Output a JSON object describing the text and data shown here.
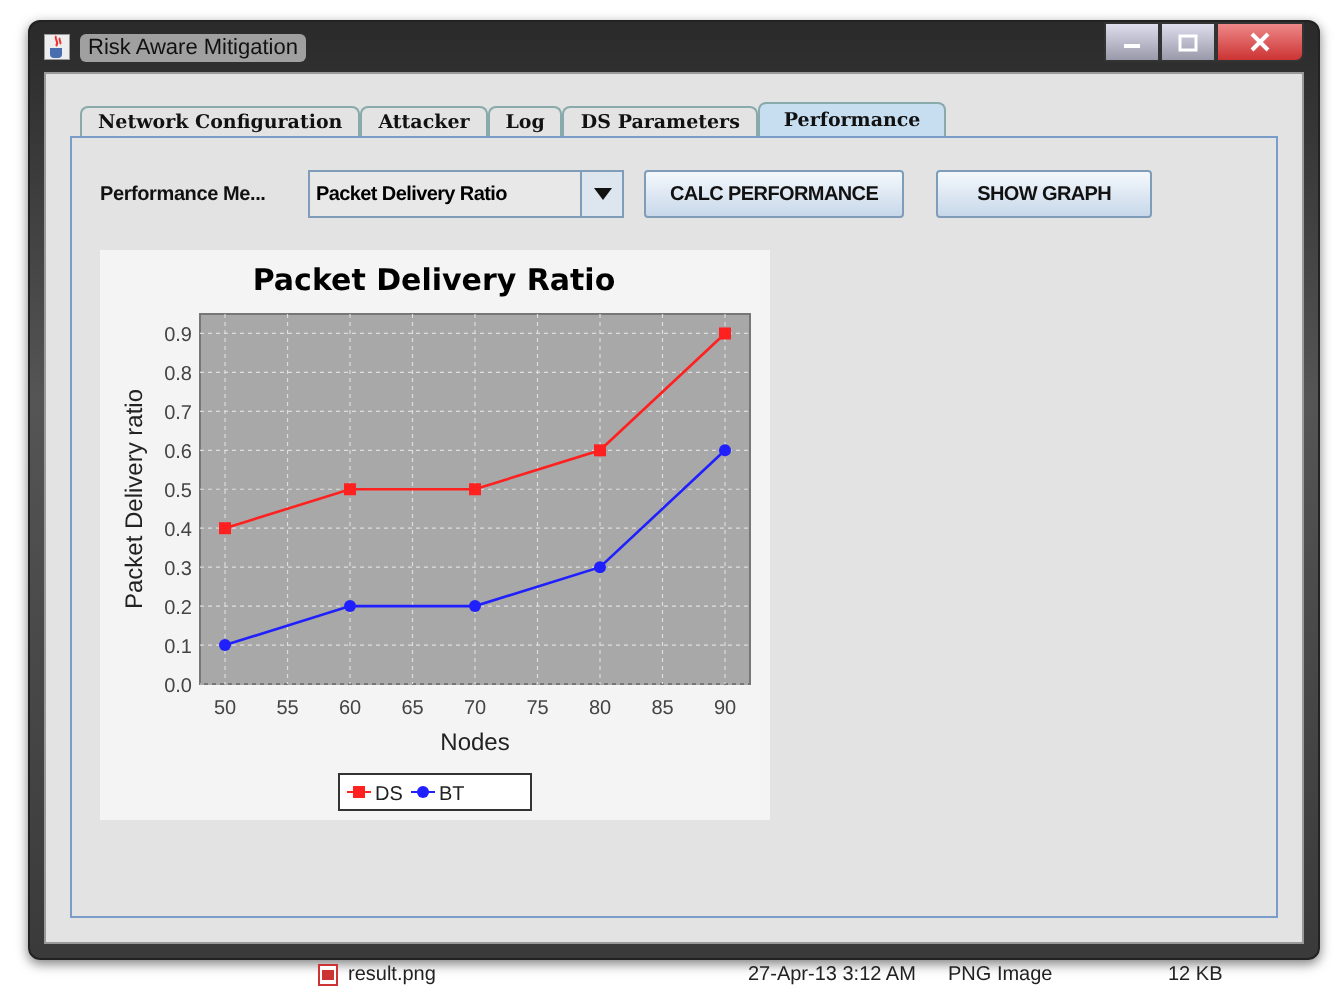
{
  "window": {
    "title": "Risk Aware Mitigation"
  },
  "tabs": [
    {
      "label": "Network Configuration",
      "selected": false
    },
    {
      "label": "Attacker",
      "selected": false
    },
    {
      "label": "Log",
      "selected": false
    },
    {
      "label": "DS Parameters",
      "selected": false
    },
    {
      "label": "Performance",
      "selected": true
    }
  ],
  "controls": {
    "label": "Performance Me...",
    "dropdown": {
      "value": "Packet Delivery Ratio"
    },
    "buttons": [
      "CALC PERFORMANCE",
      "SHOW GRAPH"
    ]
  },
  "chart": {
    "chart_data": {
      "type": "line",
      "title": "Packet Delivery Ratio",
      "xlabel": "Nodes",
      "ylabel": "Packet Delivery ratio",
      "x": [
        50,
        60,
        70,
        80,
        90
      ],
      "series": [
        {
          "name": "DS",
          "color": "#ff2020",
          "marker": "square",
          "values": [
            0.4,
            0.5,
            0.5,
            0.6,
            0.9
          ]
        },
        {
          "name": "BT",
          "color": "#2020ff",
          "marker": "circle",
          "values": [
            0.1,
            0.2,
            0.2,
            0.3,
            0.6
          ]
        }
      ],
      "grid": true,
      "legend": true,
      "xlim": [
        48,
        92
      ],
      "ylim": [
        0,
        0.95
      ],
      "xticks": [
        50,
        55,
        60,
        65,
        70,
        75,
        80,
        85,
        90
      ],
      "yticks": [
        {
          "value": 0,
          "label": "0.0"
        },
        {
          "value": 0.1,
          "label": "0.1"
        },
        {
          "value": 0.2,
          "label": "0.2"
        },
        {
          "value": 0.3,
          "label": "0.3"
        },
        {
          "value": 0.4,
          "label": "0.4"
        },
        {
          "value": 0.5,
          "label": "0.5"
        },
        {
          "value": 0.6,
          "label": "0.6"
        },
        {
          "value": 0.7,
          "label": "0.7"
        },
        {
          "value": 0.8,
          "label": "0.8"
        },
        {
          "value": 0.9,
          "label": "0.9"
        }
      ]
    }
  },
  "background_file": {
    "name": "result.png",
    "date": "27-Apr-13 3:12 AM",
    "type": "PNG Image",
    "size": "12 KB"
  }
}
